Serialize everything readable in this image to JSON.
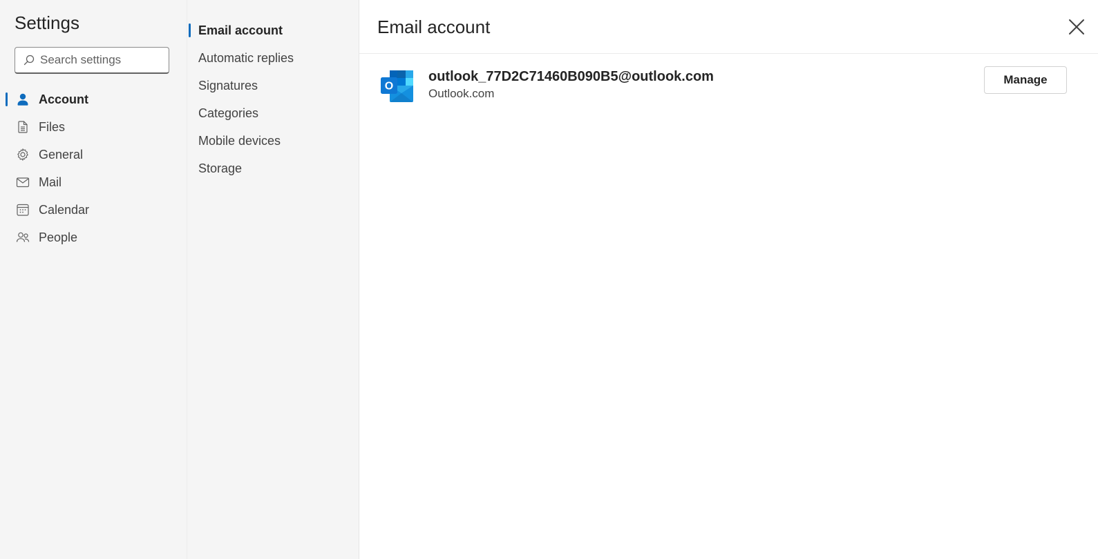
{
  "left_nav": {
    "title": "Settings",
    "search": {
      "placeholder": "Search settings",
      "value": ""
    },
    "items": [
      {
        "label": "Account",
        "icon": "person-icon",
        "active": true
      },
      {
        "label": "Files",
        "icon": "document-icon",
        "active": false
      },
      {
        "label": "General",
        "icon": "gear-icon",
        "active": false
      },
      {
        "label": "Mail",
        "icon": "mail-icon",
        "active": false
      },
      {
        "label": "Calendar",
        "icon": "calendar-icon",
        "active": false
      },
      {
        "label": "People",
        "icon": "people-icon",
        "active": false
      }
    ]
  },
  "sub_nav": {
    "items": [
      {
        "label": "Email account",
        "active": true
      },
      {
        "label": "Automatic replies",
        "active": false
      },
      {
        "label": "Signatures",
        "active": false
      },
      {
        "label": "Categories",
        "active": false
      },
      {
        "label": "Mobile devices",
        "active": false
      },
      {
        "label": "Storage",
        "active": false
      }
    ]
  },
  "main": {
    "title": "Email account",
    "close_icon": "close-icon",
    "account": {
      "email": "outlook_77D2C71460B090B5@outlook.com",
      "type": "Outlook.com",
      "logo_icon": "outlook-logo-icon",
      "logo_letter": "O",
      "manage_label": "Manage"
    }
  },
  "colors": {
    "accent": "#0f6cbd",
    "nav_background": "#f5f5f5",
    "main_background": "#ffffff",
    "text_primary": "#242424"
  }
}
